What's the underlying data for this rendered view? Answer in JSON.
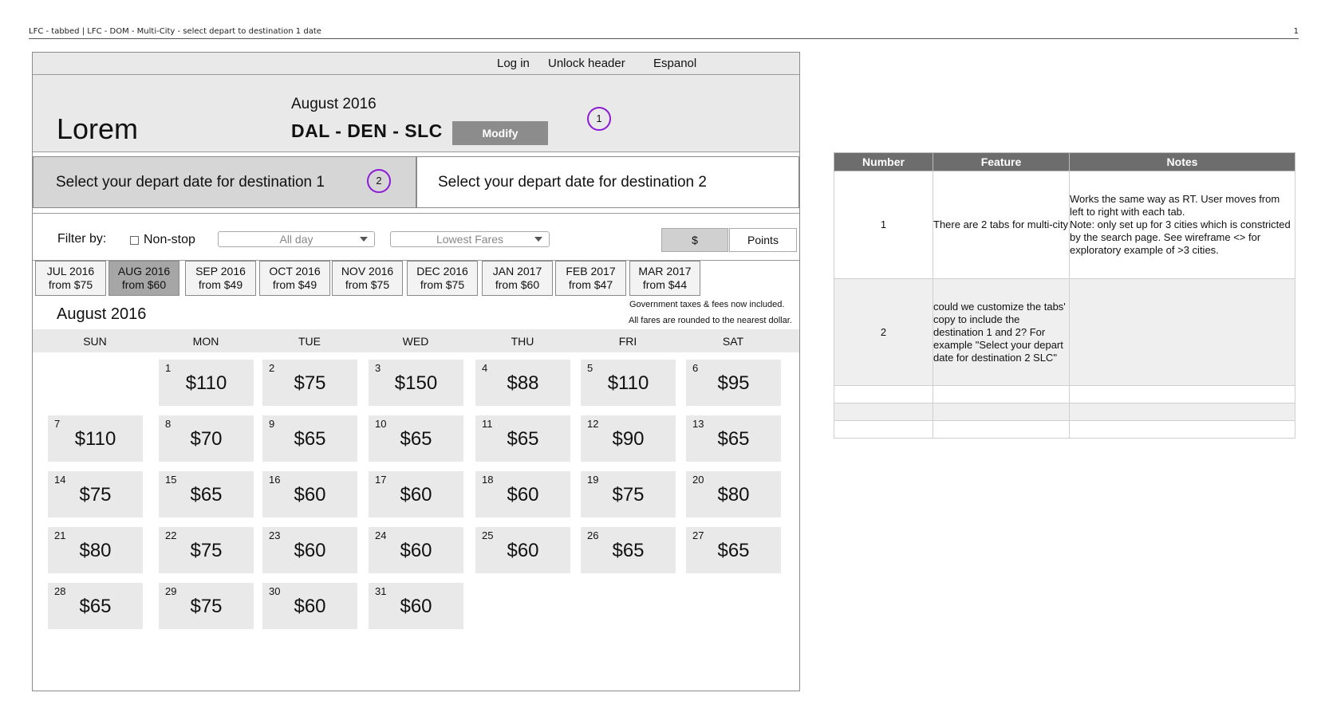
{
  "page_header": {
    "title": "LFC - tabbed | LFC - DOM - Multi-City - select depart to destination 1 date",
    "page_number": "1"
  },
  "top_links": [
    "Log in",
    "Unlock header",
    "Espanol"
  ],
  "hero": {
    "logo": "Lorem",
    "month": "August 2016",
    "route": "DAL - DEN - SLC",
    "modify_label": "Modify",
    "callout": "1"
  },
  "dest_tabs": {
    "tab1": "Select your depart date for destination 1",
    "tab2": "Select your depart date for destination 2",
    "callout": "2"
  },
  "filter": {
    "label": "Filter by:",
    "nonstop": "Non-stop",
    "time_select": "All day",
    "fare_select": "Lowest Fares",
    "currency": "$",
    "points": "Points"
  },
  "month_tabs": [
    {
      "month": "JUL 2016",
      "from": "from $75"
    },
    {
      "month": "AUG 2016",
      "from": "from $60"
    },
    {
      "month": "SEP 2016",
      "from": "from $49"
    },
    {
      "month": "OCT 2016",
      "from": "from $49"
    },
    {
      "month": "NOV 2016",
      "from": "from $75"
    },
    {
      "month": "DEC 2016",
      "from": "from $75"
    },
    {
      "month": "JAN 2017",
      "from": "from $60"
    },
    {
      "month": "FEB 2017",
      "from": "from $47"
    },
    {
      "month": "MAR 2017",
      "from": "from $44"
    }
  ],
  "active_month_index": 1,
  "calendar": {
    "title": "August 2016",
    "note_taxes": "Government taxes & fees now included.",
    "note_rounded": "All fares are rounded to the nearest dollar.",
    "weekdays": [
      "SUN",
      "MON",
      "TUE",
      "WED",
      "THU",
      "FRI",
      "SAT"
    ],
    "first_weekday_index": 1,
    "days": [
      {
        "d": "1",
        "p": "$110"
      },
      {
        "d": "2",
        "p": "$75"
      },
      {
        "d": "3",
        "p": "$150"
      },
      {
        "d": "4",
        "p": "$88"
      },
      {
        "d": "5",
        "p": "$110"
      },
      {
        "d": "6",
        "p": "$95"
      },
      {
        "d": "7",
        "p": "$110"
      },
      {
        "d": "8",
        "p": "$70"
      },
      {
        "d": "9",
        "p": "$65"
      },
      {
        "d": "10",
        "p": "$65"
      },
      {
        "d": "11",
        "p": "$65"
      },
      {
        "d": "12",
        "p": "$90"
      },
      {
        "d": "13",
        "p": "$65"
      },
      {
        "d": "14",
        "p": "$75"
      },
      {
        "d": "15",
        "p": "$65"
      },
      {
        "d": "16",
        "p": "$60"
      },
      {
        "d": "17",
        "p": "$60"
      },
      {
        "d": "18",
        "p": "$60"
      },
      {
        "d": "19",
        "p": "$75"
      },
      {
        "d": "20",
        "p": "$80"
      },
      {
        "d": "21",
        "p": "$80"
      },
      {
        "d": "22",
        "p": "$75"
      },
      {
        "d": "23",
        "p": "$60"
      },
      {
        "d": "24",
        "p": "$60"
      },
      {
        "d": "25",
        "p": "$60"
      },
      {
        "d": "26",
        "p": "$65"
      },
      {
        "d": "27",
        "p": "$65"
      },
      {
        "d": "28",
        "p": "$65"
      },
      {
        "d": "29",
        "p": "$75"
      },
      {
        "d": "30",
        "p": "$60"
      },
      {
        "d": "31",
        "p": "$60"
      }
    ]
  },
  "notes_table": {
    "headers": [
      "Number",
      "Feature",
      "Notes"
    ],
    "rows": [
      {
        "number": "1",
        "feature": "There are 2 tabs for multi-city",
        "notes": "Works the same way as RT. User moves from left to right with each tab.\nNote: only set up for 3 cities which is constricted by the search page. See wireframe <> for exploratory example of >3 cities."
      },
      {
        "number": "2",
        "feature": "could we customize the tabs' copy to include the destination 1 and 2? For example \"Select your depart date for destination 2 SLC\"",
        "notes": ""
      }
    ]
  },
  "colors": {
    "callout_ring": "#8b1bd6",
    "header_gray": "#6d6d6d",
    "active_tab": "#d6d6d6",
    "day_cell": "#e9e9e9"
  }
}
